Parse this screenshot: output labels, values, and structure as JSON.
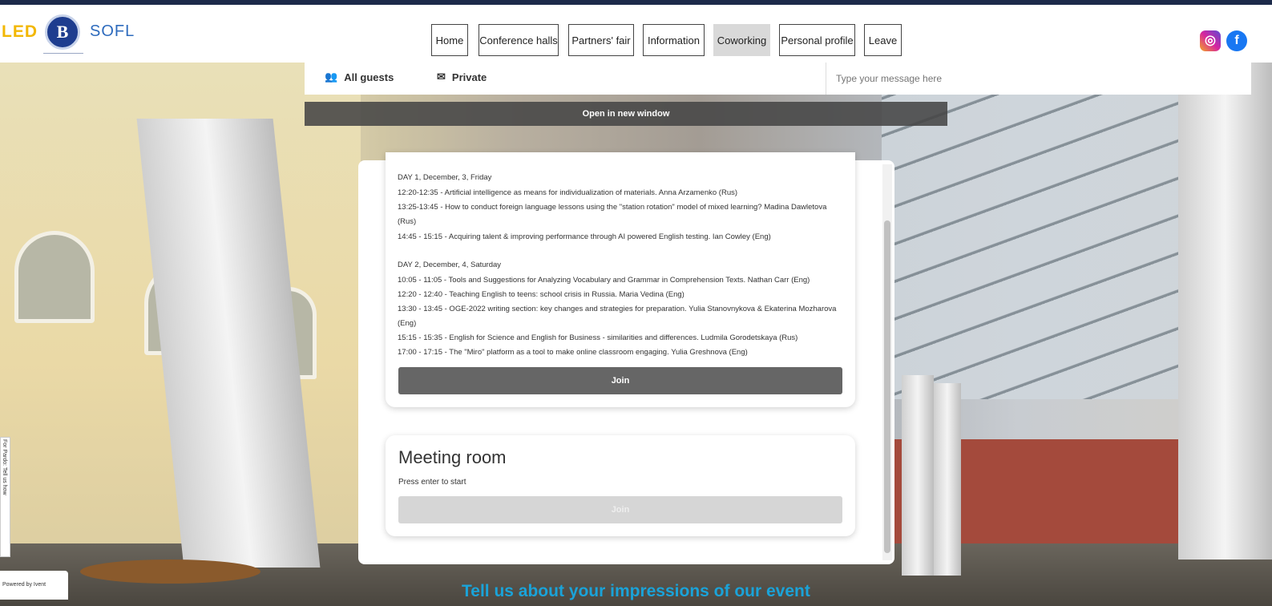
{
  "header": {
    "logos": {
      "led": "LED",
      "hse": "B",
      "sofl": "SOFL"
    },
    "nav": [
      {
        "label": "Home"
      },
      {
        "label": "Conference halls"
      },
      {
        "label": "Partners' fair"
      },
      {
        "label": "Information"
      },
      {
        "label": "Coworking",
        "active": true
      },
      {
        "label": "Personal profile"
      },
      {
        "label": "Leave"
      }
    ],
    "social": {
      "instagram_icon": "instagram-icon",
      "facebook_icon": "facebook-icon"
    }
  },
  "chat": {
    "tab_all": "All guests",
    "tab_private": "Private",
    "input_placeholder": "Type your message here",
    "open_window": "Open in new window"
  },
  "program": {
    "lines": [
      "DAY 1, December, 3, Friday",
      "12:20-12:35 - Artificial intelligence as means for individualization of materials. Anna Arzamenko (Rus)",
      "13:25-13:45 - How to conduct foreign language lessons using the \"station rotation\" model of mixed learning? Madina Dawletova",
      "(Rus)",
      "14:45 - 15:15 - Acquiring talent & improving performance through AI powered English testing. Ian Cowley (Eng)",
      "",
      "DAY 2, December, 4, Saturday",
      "10:05 - 11:05 - Tools and Suggestions for Analyzing Vocabulary and Grammar in Comprehension Texts. Nathan Carr (Eng)",
      "12:20 - 12:40 - Teaching English to teens: school crisis in Russia. Maria Vedina (Eng)",
      "13:30 - 13:45 - OGE-2022 writing section: key changes and strategies for preparation. Yulia Stanovnykova & Ekaterina Mozharova",
      "(Eng)",
      "15:15 - 15:35 - English for Science and English for Business - similarities and differences. Ludmila Gorodetskaya (Rus)",
      "17:00 - 17:15 - The \"Miro\" platform as a tool to make online classroom engaging. Yulia Greshnova (Eng)"
    ],
    "join_label": "Join"
  },
  "meeting": {
    "title": "Meeting room",
    "subtitle": "Press enter to start",
    "join_label": "Join"
  },
  "footer": {
    "feedback": "Tell us about your impressions of our event",
    "powered": "Powered by Ivent",
    "side_tab": "For Pardo: Tell us how"
  }
}
